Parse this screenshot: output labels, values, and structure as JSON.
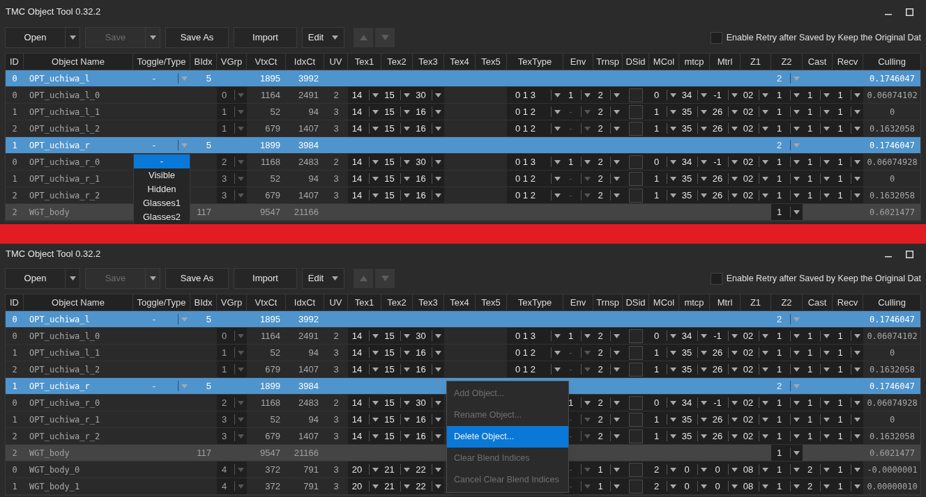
{
  "windows": [
    {
      "title": "TMC Object Tool 0.32.2",
      "toolbar": [
        {
          "label": "Open",
          "kind": "split",
          "disabled": false
        },
        {
          "label": "Save",
          "kind": "split",
          "disabled": true
        },
        {
          "label": "Save As",
          "kind": "plain",
          "disabled": false
        },
        {
          "label": "Import",
          "kind": "plain",
          "disabled": false
        },
        {
          "label": "Edit",
          "kind": "menu",
          "disabled": false
        }
      ],
      "retry_option": {
        "label": "Enable Retry after Saved by Keep the Original Dat",
        "checked": false
      },
      "table": {
        "columns": [
          "ID",
          "Object Name",
          "Toggle/Type",
          "BIdx",
          "VGrp",
          "VtxCt",
          "IdxCt",
          "UV",
          "Tex1",
          "Tex2",
          "Tex3",
          "Tex4",
          "Tex5",
          "TexType",
          "Env",
          "Trnsp",
          "DSid",
          "MCol",
          "mtcp",
          "Mtrl",
          "Z1",
          "Z2",
          "Cast",
          "Recv",
          "Culling"
        ],
        "rows": [
          {
            "kind": "group",
            "selected": true,
            "id": "0",
            "object_name": "OPT_uchiwa_l",
            "toggle_type": "-",
            "bidx": "5",
            "vtxct": "1895",
            "idxct": "3992",
            "z2": "2",
            "culling": "0.1746047"
          },
          {
            "kind": "part",
            "selected": false,
            "id": "0",
            "object_name": "OPT_uchiwa_l_0",
            "vgrp": "0",
            "vtxct": "1164",
            "idxct": "2491",
            "uv": "2",
            "tex1": "14",
            "tex2": "15",
            "tex3": "30",
            "textype": "0 1 3",
            "env": {
              "text": "1",
              "disabled": false
            },
            "trnsp": "2",
            "dsid": {
              "checked": false
            },
            "mcol": "0",
            "mtcp": "34",
            "mtrl": "-1",
            "z1": "02",
            "z2": "1",
            "cast": "1",
            "recv": "1",
            "culling": "0.06074102"
          },
          {
            "kind": "part",
            "selected": false,
            "id": "1",
            "object_name": "OPT_uchiwa_l_1",
            "vgrp": "1",
            "vtxct": "52",
            "idxct": "94",
            "uv": "3",
            "tex1": "14",
            "tex2": "15",
            "tex3": "16",
            "textype": "0 1 2",
            "env": {
              "text": "-",
              "disabled": true
            },
            "trnsp": "2",
            "dsid": {
              "checked": false
            },
            "mcol": "1",
            "mtcp": "35",
            "mtrl": "26",
            "z1": "02",
            "z2": "1",
            "cast": "1",
            "recv": "1",
            "culling": "0"
          },
          {
            "kind": "part",
            "selected": false,
            "id": "2",
            "object_name": "OPT_uchiwa_l_2",
            "vgrp": "1",
            "vtxct": "679",
            "idxct": "1407",
            "uv": "3",
            "tex1": "14",
            "tex2": "15",
            "tex3": "16",
            "textype": "0 1 2",
            "env": {
              "text": "-",
              "disabled": true
            },
            "trnsp": "2",
            "dsid": {
              "checked": false
            },
            "mcol": "1",
            "mtcp": "35",
            "mtrl": "26",
            "z1": "02",
            "z2": "1",
            "cast": "1",
            "recv": "1",
            "culling": "0.1632058"
          },
          {
            "kind": "group",
            "selected": true,
            "id": "1",
            "object_name": "OPT_uchiwa_r",
            "toggle_type": "-",
            "bidx": "5",
            "vtxct": "1899",
            "idxct": "3984",
            "z2": "2",
            "culling": "0.1746047"
          },
          {
            "kind": "part",
            "selected": false,
            "id": "0",
            "object_name": "OPT_uchiwa_r_0",
            "vgrp": "2",
            "vtxct": "1168",
            "idxct": "2483",
            "uv": "2",
            "tex1": "14",
            "tex2": "15",
            "tex3": "30",
            "textype": "0 1 3",
            "env": {
              "text": "1",
              "disabled": false
            },
            "trnsp": "2",
            "dsid": {
              "checked": false
            },
            "mcol": "0",
            "mtcp": "34",
            "mtrl": "-1",
            "z1": "02",
            "z2": "1",
            "cast": "1",
            "recv": "1",
            "culling": "0.06074928"
          },
          {
            "kind": "part",
            "selected": false,
            "id": "1",
            "object_name": "OPT_uchiwa_r_1",
            "vgrp": "3",
            "vtxct": "52",
            "idxct": "94",
            "uv": "3",
            "tex1": "14",
            "tex2": "15",
            "tex3": "16",
            "textype": "0 1 2",
            "env": {
              "text": "-",
              "disabled": true
            },
            "trnsp": "2",
            "dsid": {
              "checked": false
            },
            "mcol": "1",
            "mtcp": "35",
            "mtrl": "26",
            "z1": "02",
            "z2": "1",
            "cast": "1",
            "recv": "1",
            "culling": "0"
          },
          {
            "kind": "part",
            "selected": false,
            "id": "2",
            "object_name": "OPT_uchiwa_r_2",
            "vgrp": "3",
            "vtxct": "679",
            "idxct": "1407",
            "uv": "3",
            "tex1": "14",
            "tex2": "15",
            "tex3": "16",
            "textype": "0 1 2",
            "env": {
              "text": "-",
              "disabled": true
            },
            "trnsp": "2",
            "dsid": {
              "checked": false
            },
            "mcol": "1",
            "mtcp": "35",
            "mtrl": "26",
            "z1": "02",
            "z2": "1",
            "cast": "1",
            "recv": "1",
            "culling": "0.1632058"
          },
          {
            "kind": "group",
            "selected": false,
            "id": "2",
            "object_name": "WGT_body",
            "bidx": "117",
            "vtxct": "9547",
            "idxct": "21166",
            "z2": "1",
            "culling": "0.6021477"
          }
        ]
      },
      "dropdown": {
        "items": [
          {
            "label": "-",
            "selected": true
          },
          {
            "label": "Visible",
            "selected": false
          },
          {
            "label": "Hidden",
            "selected": false
          },
          {
            "label": "Glasses1",
            "selected": false
          },
          {
            "label": "Glasses2",
            "selected": false
          }
        ]
      }
    },
    {
      "title": "TMC Object Tool 0.32.2",
      "toolbar": [
        {
          "label": "Open",
          "kind": "split",
          "disabled": false
        },
        {
          "label": "Save",
          "kind": "split",
          "disabled": true
        },
        {
          "label": "Save As",
          "kind": "plain",
          "disabled": false
        },
        {
          "label": "Import",
          "kind": "plain",
          "disabled": false
        },
        {
          "label": "Edit",
          "kind": "menu",
          "disabled": false
        }
      ],
      "retry_option": {
        "label": "Enable Retry after Saved by Keep the Original Dat",
        "checked": false
      },
      "table": {
        "columns": [
          "ID",
          "Object Name",
          "Toggle/Type",
          "BIdx",
          "VGrp",
          "VtxCt",
          "IdxCt",
          "UV",
          "Tex1",
          "Tex2",
          "Tex3",
          "Tex4",
          "Tex5",
          "TexType",
          "Env",
          "Trnsp",
          "DSid",
          "MCol",
          "mtcp",
          "Mtrl",
          "Z1",
          "Z2",
          "Cast",
          "Recv",
          "Culling"
        ],
        "rows": [
          {
            "kind": "group",
            "selected": true,
            "id": "0",
            "object_name": "OPT_uchiwa_l",
            "toggle_type": "-",
            "bidx": "5",
            "vtxct": "1895",
            "idxct": "3992",
            "z2": "2",
            "culling": "0.1746047"
          },
          {
            "kind": "part",
            "selected": false,
            "id": "0",
            "object_name": "OPT_uchiwa_l_0",
            "vgrp": "0",
            "vtxct": "1164",
            "idxct": "2491",
            "uv": "2",
            "tex1": "14",
            "tex2": "15",
            "tex3": "30",
            "textype": "0 1 3",
            "env": {
              "text": "1",
              "disabled": false
            },
            "trnsp": "2",
            "dsid": {
              "checked": false
            },
            "mcol": "0",
            "mtcp": "34",
            "mtrl": "-1",
            "z1": "02",
            "z2": "1",
            "cast": "1",
            "recv": "1",
            "culling": "0.06074102"
          },
          {
            "kind": "part",
            "selected": false,
            "id": "1",
            "object_name": "OPT_uchiwa_l_1",
            "vgrp": "1",
            "vtxct": "52",
            "idxct": "94",
            "uv": "3",
            "tex1": "14",
            "tex2": "15",
            "tex3": "16",
            "textype": "0 1 2",
            "env": {
              "text": "-",
              "disabled": true
            },
            "trnsp": "2",
            "dsid": {
              "checked": false
            },
            "mcol": "1",
            "mtcp": "35",
            "mtrl": "26",
            "z1": "02",
            "z2": "1",
            "cast": "1",
            "recv": "1",
            "culling": "0"
          },
          {
            "kind": "part",
            "selected": false,
            "id": "2",
            "object_name": "OPT_uchiwa_l_2",
            "vgrp": "1",
            "vtxct": "679",
            "idxct": "1407",
            "uv": "3",
            "tex1": "14",
            "tex2": "15",
            "tex3": "16",
            "textype": "0 1 2",
            "env": {
              "text": "-",
              "disabled": true
            },
            "trnsp": "2",
            "dsid": {
              "checked": false
            },
            "mcol": "1",
            "mtcp": "35",
            "mtrl": "26",
            "z1": "02",
            "z2": "1",
            "cast": "1",
            "recv": "1",
            "culling": "0.1632058"
          },
          {
            "kind": "group",
            "selected": true,
            "id": "1",
            "object_name": "OPT_uchiwa_r",
            "toggle_type": "-",
            "bidx": "5",
            "vtxct": "1899",
            "idxct": "3984",
            "z2": "2",
            "culling": "0.1746047"
          },
          {
            "kind": "part",
            "selected": false,
            "id": "0",
            "object_name": "OPT_uchiwa_r_0",
            "vgrp": "2",
            "vtxct": "1168",
            "idxct": "2483",
            "uv": "2",
            "tex1": "14",
            "tex2": "15",
            "tex3": "30",
            "env": {
              "text": "1",
              "disabled": false
            },
            "trnsp": "2",
            "dsid": {
              "checked": false
            },
            "mcol": "0",
            "mtcp": "34",
            "mtrl": "-1",
            "z1": "02",
            "z2": "1",
            "cast": "1",
            "recv": "1",
            "culling": "0.06074928"
          },
          {
            "kind": "part",
            "selected": false,
            "id": "1",
            "object_name": "OPT_uchiwa_r_1",
            "vgrp": "3",
            "vtxct": "52",
            "idxct": "94",
            "uv": "3",
            "tex1": "14",
            "tex2": "15",
            "tex3": "16",
            "env": {
              "text": "-",
              "disabled": true
            },
            "trnsp": "2",
            "dsid": {
              "checked": false
            },
            "mcol": "1",
            "mtcp": "35",
            "mtrl": "26",
            "z1": "02",
            "z2": "1",
            "cast": "1",
            "recv": "1",
            "culling": "0"
          },
          {
            "kind": "part",
            "selected": false,
            "id": "2",
            "object_name": "OPT_uchiwa_r_2",
            "vgrp": "3",
            "vtxct": "679",
            "idxct": "1407",
            "uv": "3",
            "tex1": "14",
            "tex2": "15",
            "tex3": "16",
            "env": {
              "text": "-",
              "disabled": true
            },
            "trnsp": "2",
            "dsid": {
              "checked": false
            },
            "mcol": "1",
            "mtcp": "35",
            "mtrl": "26",
            "z1": "02",
            "z2": "1",
            "cast": "1",
            "recv": "1",
            "culling": "0.1632058"
          },
          {
            "kind": "group",
            "selected": false,
            "id": "2",
            "object_name": "WGT_body",
            "bidx": "117",
            "vtxct": "9547",
            "idxct": "21166",
            "z2": "1",
            "culling": "0.6021477"
          },
          {
            "kind": "part",
            "selected": false,
            "id": "0",
            "object_name": "WGT_body_0",
            "vgrp": "4",
            "vtxct": "372",
            "idxct": "791",
            "uv": "3",
            "tex1": "20",
            "tex2": "21",
            "tex3": "22",
            "env": {
              "text": "-",
              "disabled": true
            },
            "trnsp": "1",
            "dsid": {
              "checked": false
            },
            "mcol": "2",
            "mtcp": "0",
            "mtrl": "0",
            "z1": "08",
            "z2": "1",
            "cast": "2",
            "recv": "1",
            "culling": "-0.0000001"
          },
          {
            "kind": "part",
            "selected": false,
            "id": "1",
            "object_name": "WGT_body_1",
            "vgrp": "4",
            "vtxct": "372",
            "idxct": "791",
            "uv": "3",
            "tex1": "20",
            "tex2": "21",
            "tex3": "22",
            "env": {
              "text": "-",
              "disabled": true
            },
            "trnsp": "1",
            "dsid": {
              "checked": false
            },
            "mcol": "2",
            "mtcp": "0",
            "mtrl": "0",
            "z1": "08",
            "z2": "1",
            "cast": "2",
            "recv": "1",
            "culling": "0.00000010"
          }
        ]
      },
      "context_menu": {
        "items": [
          {
            "label": "Add Object...",
            "disabled": true,
            "selected": false
          },
          {
            "label": "Rename Object...",
            "disabled": true,
            "selected": false
          },
          {
            "label": "Delete Object...",
            "disabled": false,
            "selected": true
          },
          {
            "label": "Clear Blend Indices",
            "disabled": true,
            "selected": false
          },
          {
            "label": "Cancel Clear Blend Indices",
            "disabled": true,
            "selected": false
          }
        ]
      }
    }
  ]
}
